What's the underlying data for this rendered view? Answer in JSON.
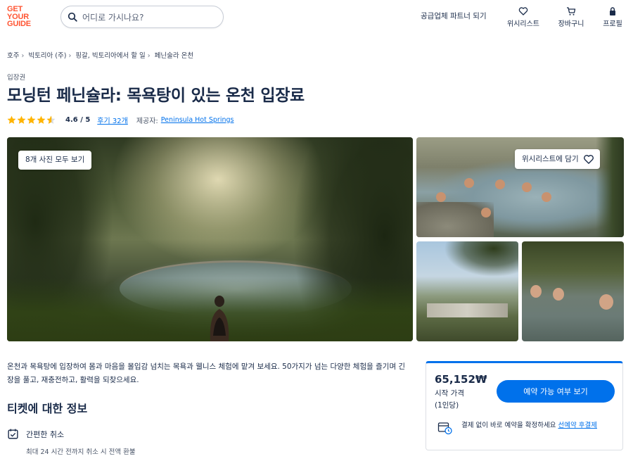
{
  "header": {
    "logo_lines": [
      "GET",
      "YOUR",
      "GUIDE"
    ],
    "search_placeholder": "어디로 가시나요?",
    "partner_link": "공급업체 파트너 되기",
    "nav": {
      "wishlist": "위시리스트",
      "cart": "장바구니",
      "profile": "프로필"
    }
  },
  "breadcrumb": [
    "호주",
    "빅토리아 (주)",
    "핑갈, 빅토리아에서 할 일",
    "페닌술라 온천"
  ],
  "product": {
    "category": "입장권",
    "title": "모닝턴 페닌슐라: 목욕탕이 있는 온천 입장료",
    "rating": 4.6,
    "rating_text": "4.6 / 5",
    "reviews_link": "후기 32개",
    "provider_label": "제공자:",
    "provider_name": "Peninsula Hot Springs"
  },
  "gallery": {
    "view_all_button": "8개 사진 모두 보기",
    "wishlist_button": "위시리스트에 담기"
  },
  "description": "온천과 목욕탕에 입장하여 몸과 마음을 몰입감 넘치는 목욕과 웰니스 체험에 맡겨 보세요. 50가지가 넘는 다양한 체험을 즐기며 긴장을 풀고, 재충전하고, 활력을 되찾으세요.",
  "ticket_info": {
    "section_title": "티켓에 대한 정보",
    "cancel_title": "간편한 취소",
    "cancel_detail": "최대 24 시간 전까지 취소 시 전액 환불"
  },
  "booking": {
    "price": "65,152₩",
    "price_label": "시작 가격",
    "per_person": "(1인당)",
    "cta": "예약 가능 여부 보기",
    "note_text": "결제 없이 바로 예약을 확정하세요 ",
    "note_link": "선예약 후결제"
  },
  "colors": {
    "brand": "#ff5533",
    "accent": "#0071eb",
    "text": "#1a2b49",
    "star": "#ffb400"
  }
}
